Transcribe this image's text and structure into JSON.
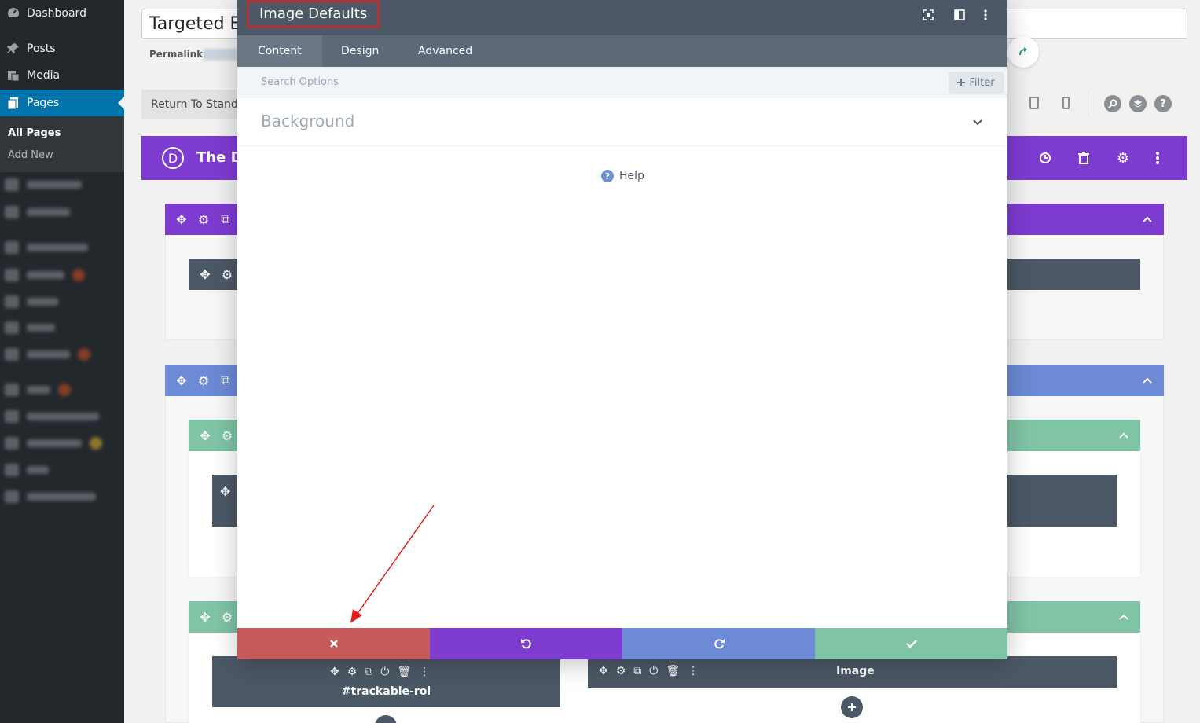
{
  "sidebar": {
    "dashboard": "Dashboard",
    "posts": "Posts",
    "media": "Media",
    "pages": "Pages",
    "all_pages": "All Pages",
    "add_new": "Add New"
  },
  "editor": {
    "title_value": "Targeted Er",
    "permalink_label": "Permalink:",
    "return_button": "Return To Standard Editor",
    "builder_title": "The Di"
  },
  "modal": {
    "title": "Image Defaults",
    "tabs": [
      "Content",
      "Design",
      "Advanced"
    ],
    "search_placeholder": "Search Options",
    "filter_label": "Filter",
    "section_title": "Background",
    "help_label": "Help"
  },
  "modules": {
    "module_left_label": "#trackable-roi",
    "module_right_label": "Image"
  },
  "colors": {
    "purple": "#7e3bd0",
    "blue": "#6c8ad5",
    "green": "#80c4a6",
    "dark": "#4c5866",
    "cancel": "#c45a5a",
    "wp_blue": "#0073aa"
  }
}
